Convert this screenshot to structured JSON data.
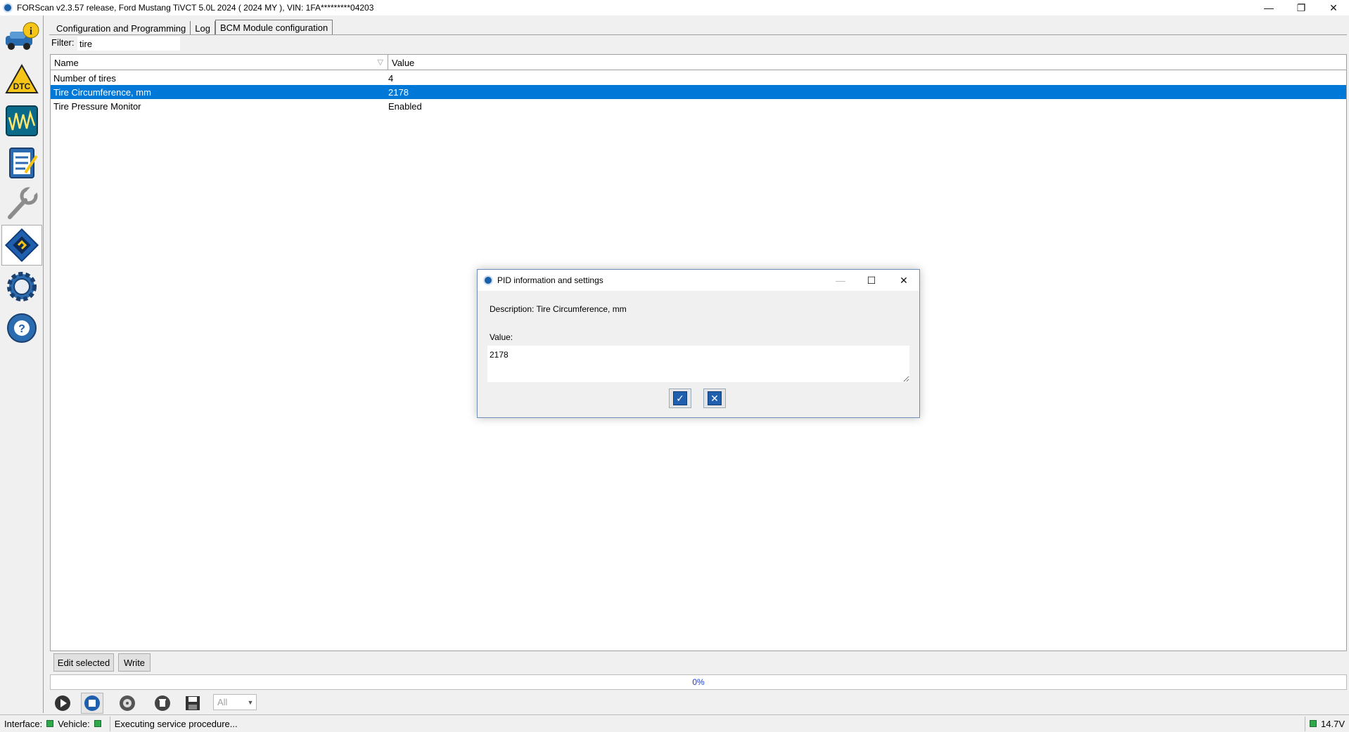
{
  "window": {
    "title": "FORScan v2.3.57 release, Ford Mustang TiVCT 5.0L 2024 ( 2024 MY ), VIN: 1FA*********04203",
    "minimize": "—",
    "maximize": "❐",
    "close": "✕"
  },
  "toolbar": {
    "items": [
      "vehicle-info",
      "dtc",
      "oscilloscope",
      "tests",
      "service",
      "configuration-programming",
      "settings",
      "help"
    ],
    "active": "configuration-programming"
  },
  "tabs": [
    {
      "label": "Configuration and Programming"
    },
    {
      "label": "Log"
    },
    {
      "label": "BCM Module configuration"
    }
  ],
  "filter": {
    "label": "Filter:",
    "value": "tire"
  },
  "table": {
    "columns": {
      "name": "Name",
      "value": "Value"
    },
    "rows": [
      {
        "name": "Number of tires",
        "value": "4"
      },
      {
        "name": "Tire Circumference, mm",
        "value": "2178"
      },
      {
        "name": "Tire Pressure Monitor",
        "value": "Enabled"
      }
    ],
    "selected_index": 1
  },
  "buttons": {
    "edit_selected": "Edit selected",
    "write": "Write"
  },
  "progress": {
    "text": "0%"
  },
  "controls": {
    "dropdown_value": "All"
  },
  "status": {
    "interface_label": "Interface:",
    "vehicle_label": "Vehicle:",
    "message": "Executing service procedure...",
    "voltage": "14.7V"
  },
  "dialog": {
    "title": "PID information and settings",
    "description": "Description: Tire Circumference, mm",
    "value_label": "Value:",
    "value": "2178",
    "ok_glyph": "✓",
    "cancel_glyph": "✕"
  },
  "colors": {
    "selection": "#0078d7",
    "accent": "#1f5fae",
    "status_led": "#2ea84a"
  }
}
